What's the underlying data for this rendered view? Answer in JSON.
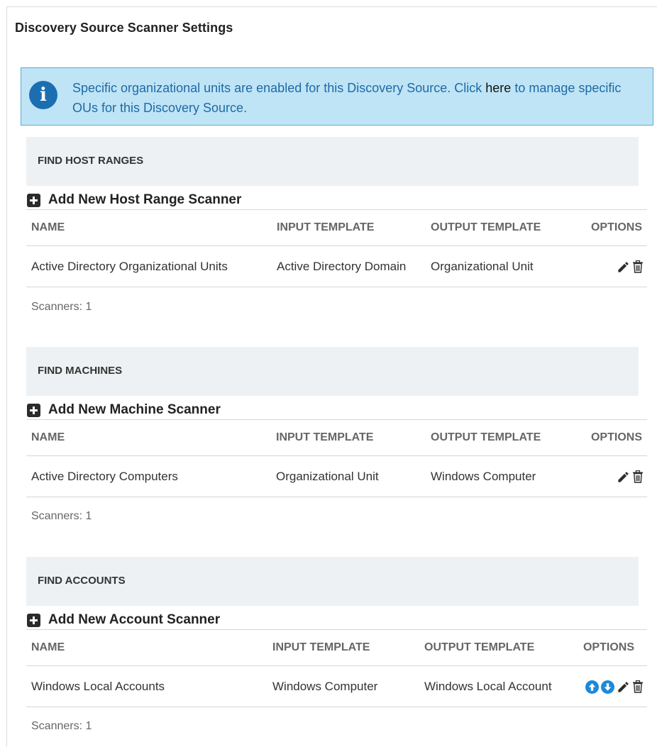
{
  "page": {
    "title": "Discovery Source Scanner Settings"
  },
  "info": {
    "text_before": "Specific organizational units are enabled for this Discovery Source. Click ",
    "link": "here",
    "text_after": " to manage specific OUs for this Discovery Source."
  },
  "columns": {
    "name": "NAME",
    "input": "INPUT TEMPLATE",
    "output": "OUTPUT TEMPLATE",
    "options": "OPTIONS"
  },
  "sections": {
    "host_ranges": {
      "title": "FIND HOST RANGES",
      "add_label": "Add New Host Range Scanner",
      "row": {
        "name": "Active Directory Organizational Units",
        "input": "Active Directory Domain",
        "output": "Organizational Unit"
      },
      "count": "Scanners: 1"
    },
    "machines": {
      "title": "FIND MACHINES",
      "add_label": "Add New Machine Scanner",
      "row": {
        "name": "Active Directory Computers",
        "input": "Organizational Unit",
        "output": "Windows Computer"
      },
      "count": "Scanners: 1"
    },
    "accounts": {
      "title": "FIND ACCOUNTS",
      "add_label": "Add New Account Scanner",
      "row": {
        "name": "Windows Local Accounts",
        "input": "Windows Computer",
        "output": "Windows Local Account"
      },
      "count": "Scanners: 1"
    }
  },
  "icons": {
    "info": "info-icon",
    "add": "plus-square-icon",
    "edit": "pencil-icon",
    "delete": "trash-icon",
    "move_up": "arrow-up-circle-icon",
    "move_down": "arrow-down-circle-icon"
  },
  "colors": {
    "info_background": "#bfe4f6",
    "info_border": "#5aa9d2",
    "info_text": "#1e6aa6",
    "info_icon": "#1b6fb1",
    "section_bar": "#eef1f3",
    "move_arrows": "#1c8ad9"
  }
}
